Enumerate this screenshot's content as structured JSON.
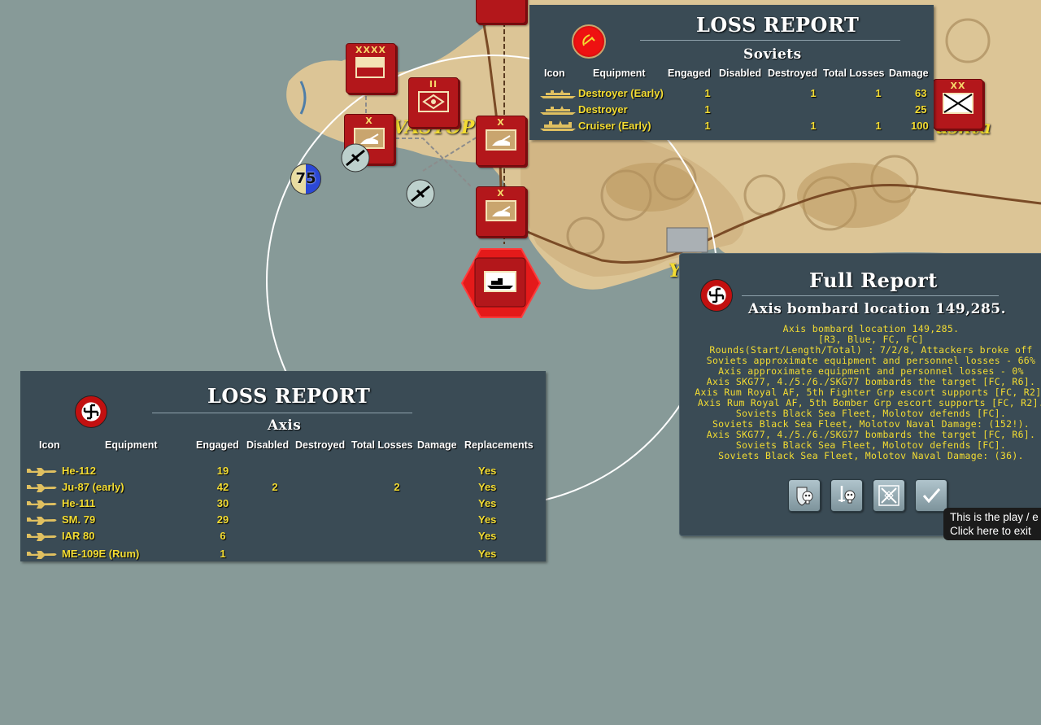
{
  "map": {
    "city_label_sevastopol": "VASTOP",
    "city_label_alushta": "ushta",
    "city_label_yalta": "Y",
    "unit_strength_marker": "75",
    "unit_sizes": {
      "army": "XXXX",
      "battalion": "II",
      "brigade": "X",
      "division": "XX"
    }
  },
  "soviet_report": {
    "title": "LOSS REPORT",
    "side": "Soviets",
    "columns": [
      "Icon",
      "Equipment",
      "Engaged",
      "Disabled",
      "Destroyed",
      "Total Losses",
      "Damage"
    ],
    "rows": [
      {
        "equipment": "Destroyer (Early)",
        "engaged": "1",
        "disabled": "",
        "destroyed": "1",
        "total_losses": "1",
        "damage": "63"
      },
      {
        "equipment": "Destroyer",
        "engaged": "1",
        "disabled": "",
        "destroyed": "",
        "total_losses": "",
        "damage": "25"
      },
      {
        "equipment": "Cruiser (Early)",
        "engaged": "1",
        "disabled": "",
        "destroyed": "1",
        "total_losses": "1",
        "damage": "100"
      }
    ]
  },
  "axis_report": {
    "title": "LOSS REPORT",
    "side": "Axis",
    "columns": [
      "Icon",
      "Equipment",
      "Engaged",
      "Disabled",
      "Destroyed",
      "Total Losses",
      "Damage",
      "Replacements"
    ],
    "rows": [
      {
        "equipment": "He-112",
        "engaged": "19",
        "disabled": "",
        "destroyed": "",
        "total_losses": "",
        "damage": "",
        "replacements": "Yes"
      },
      {
        "equipment": "Ju-87 (early)",
        "engaged": "42",
        "disabled": "2",
        "destroyed": "",
        "total_losses": "2",
        "damage": "",
        "replacements": "Yes"
      },
      {
        "equipment": "He-111",
        "engaged": "30",
        "disabled": "",
        "destroyed": "",
        "total_losses": "",
        "damage": "",
        "replacements": "Yes"
      },
      {
        "equipment": "SM. 79",
        "engaged": "29",
        "disabled": "",
        "destroyed": "",
        "total_losses": "",
        "damage": "",
        "replacements": "Yes"
      },
      {
        "equipment": "IAR 80",
        "engaged": "6",
        "disabled": "",
        "destroyed": "",
        "total_losses": "",
        "damage": "",
        "replacements": "Yes"
      },
      {
        "equipment": "ME-109E (Rum)",
        "engaged": "1",
        "disabled": "",
        "destroyed": "",
        "total_losses": "",
        "damage": "",
        "replacements": "Yes"
      }
    ]
  },
  "full_report": {
    "title": "Full Report",
    "subtitle": "Axis bombard location 149,285.",
    "log": [
      "Axis bombard location 149,285.",
      "[R3, Blue, FC, FC]",
      "Rounds(Start/Length/Total) : 7/2/8, Attackers broke off",
      "Soviets approximate equipment and personnel losses - 66%",
      "Axis approximate equipment and personnel losses - 0%",
      "Axis SKG77, 4./5./6./SKG77 bombards the target [FC, R6].",
      "Axis Rum Royal AF, 5th Fighter Grp escort supports [FC, R2].",
      "Axis Rum Royal AF, 5th Bomber Grp escort supports [FC, R2].",
      "Soviets Black Sea Fleet, Molotov defends [FC].",
      "Soviets Black Sea Fleet, Molotov Naval Damage: (152!).",
      "Axis SKG77, 4./5./6./SKG77 bombards the target [FC, R6].",
      "Soviets Black Sea Fleet, Molotov defends [FC].",
      "Soviets Black Sea Fleet, Molotov Naval Damage: (36)."
    ],
    "buttons": [
      "shield-skull-icon",
      "sword-skull-icon",
      "crossed-swords-icon",
      "checkmark-icon"
    ]
  },
  "tooltip": {
    "line1": "This is the play / e",
    "line2": "Click here to exit"
  },
  "colors": {
    "sea": "#879a98",
    "land": "#dcc596",
    "panel": "#3a4b55",
    "value_text": "#f3dc32",
    "soviet_counter": "#b3171b"
  }
}
